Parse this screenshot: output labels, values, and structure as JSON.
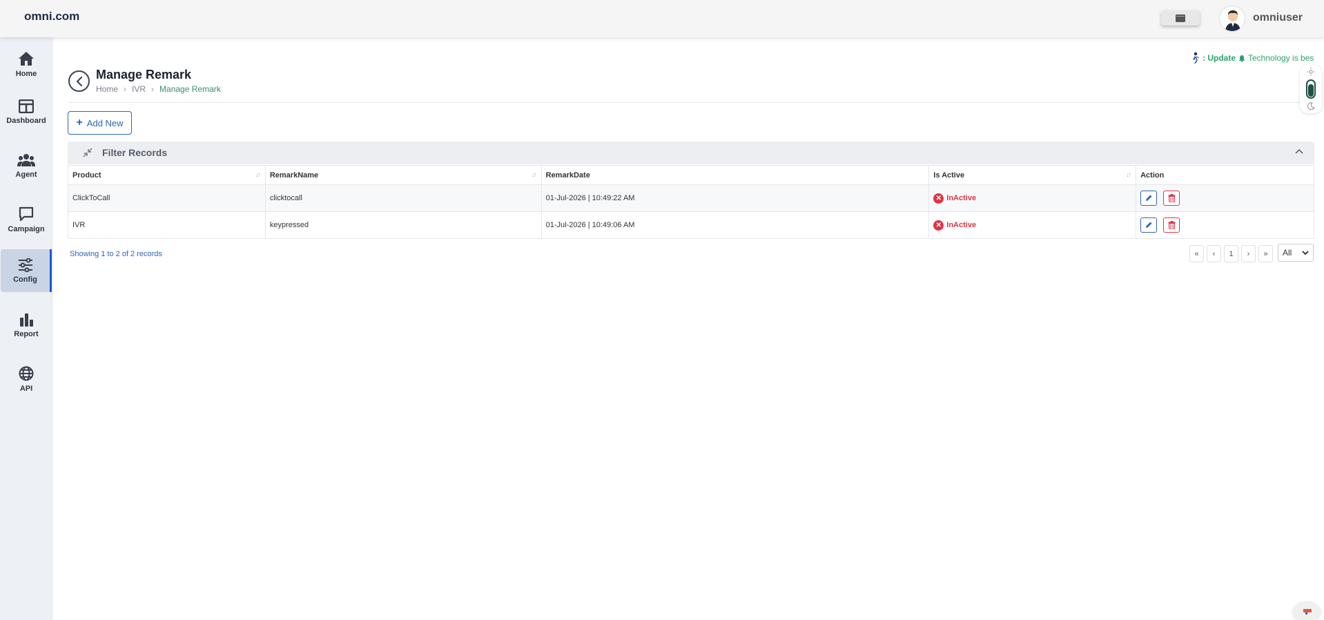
{
  "header": {
    "brand": "omni.com",
    "username": "omniuser"
  },
  "sidebar": {
    "items": [
      {
        "label": "Home",
        "icon": "home-icon"
      },
      {
        "label": "Dashboard",
        "icon": "dashboard-icon"
      },
      {
        "label": "Agent",
        "icon": "users-icon"
      },
      {
        "label": "Campaign",
        "icon": "chat-icon"
      },
      {
        "label": "Config",
        "icon": "sliders-icon",
        "active": true
      },
      {
        "label": "Report",
        "icon": "bar-chart-icon"
      },
      {
        "label": "API",
        "icon": "globe-icon"
      }
    ]
  },
  "page": {
    "title": "Manage Remark",
    "breadcrumb": [
      "Home",
      "IVR",
      "Manage Remark"
    ],
    "ticker_update": ": Update",
    "ticker_message": "Technology is bes"
  },
  "toolbar": {
    "add_label": "Add New"
  },
  "filter": {
    "title": "Filter Records"
  },
  "table": {
    "columns": [
      "Product",
      "RemarkName",
      "RemarkDate",
      "Is Active",
      "Action"
    ],
    "rows": [
      {
        "product": "ClickToCall",
        "remark_name": "clicktocall",
        "remark_date": "01-Jul-2026 | 10:49:22 AM",
        "status": "InActive"
      },
      {
        "product": "IVR",
        "remark_name": "keypressed",
        "remark_date": "01-Jul-2026 | 10:49:06 AM",
        "status": "InActive"
      }
    ]
  },
  "pagination": {
    "summary": "Showing 1 to 2 of 2 records",
    "first": "«",
    "prev": "‹",
    "page": "1",
    "next": "›",
    "last": "»",
    "page_size": "All"
  },
  "colors": {
    "accent": "#2c64b8",
    "danger": "#dc3545",
    "success": "#2aa36b",
    "sidebar_bg": "#edf0f5"
  }
}
